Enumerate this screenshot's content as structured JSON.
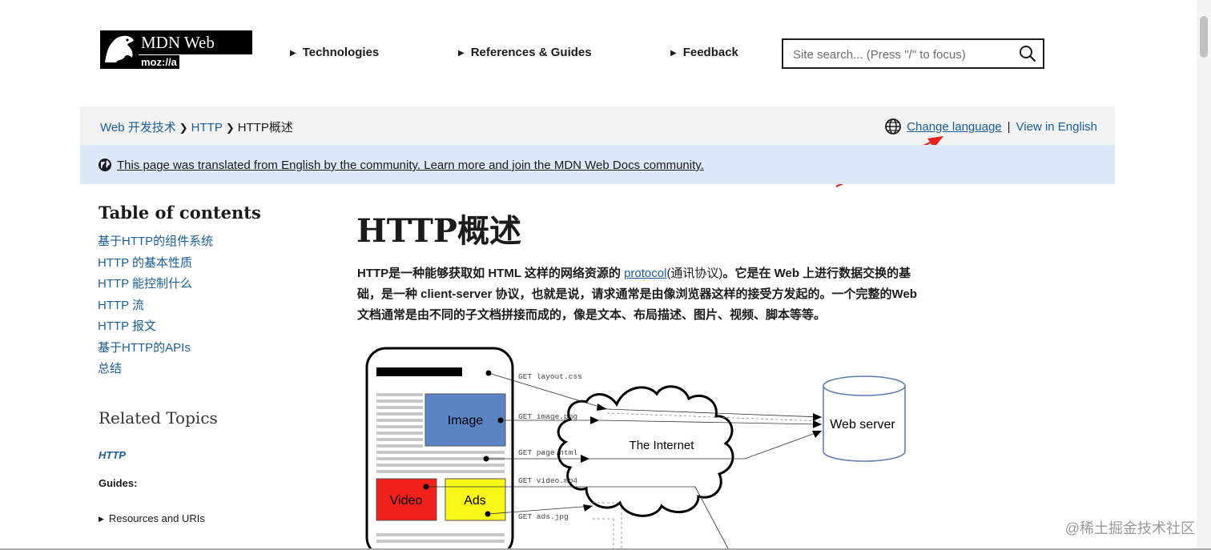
{
  "header": {
    "logo": {
      "name": "MDN Web Docs",
      "moz": "moz://a"
    },
    "nav": [
      {
        "label": "Technologies"
      },
      {
        "label": "References & Guides"
      },
      {
        "label": "Feedback"
      }
    ],
    "search": {
      "placeholder": "Site search... (Press \"/\" to focus)",
      "icon": "search-icon"
    }
  },
  "breadcrumb": {
    "items": [
      "Web 开发技术",
      "HTTP",
      "HTTP概述"
    ],
    "change_language": "Change language",
    "view_in_english": "View in English",
    "separator": "|"
  },
  "notice": {
    "text": "This page was translated from English by the community. Learn more and join the MDN Web Docs community."
  },
  "sidebar": {
    "toc_title": "Table of contents",
    "toc": [
      "基于HTTP的组件系统",
      "HTTP 的基本性质",
      "HTTP 能控制什么",
      "HTTP 流",
      "HTTP 报文",
      "基于HTTP的APIs",
      "总结"
    ],
    "related_title": "Related Topics",
    "related_http": "HTTP",
    "guides_label": "Guides:",
    "resources": "Resources and URIs"
  },
  "main": {
    "title": "HTTP概述",
    "intro_before": "HTTP是一种能够获取如 HTML 这样的网络资源的 ",
    "intro_link": "protocol",
    "intro_paren": "(通讯协议)",
    "intro_after": "。它是在 Web 上进行数据交换的基础，是一种 client-server 协议，也就是说，请求通常是由像浏览器这样的接受方发起的。一个完整的Web文档通常是由不同的子文档拼接而成的，像是文本、布局描述、图片、视频、脚本等等。",
    "diagram": {
      "image_label": "Image",
      "video_label": "Video",
      "ads_label": "Ads",
      "internet_label": "The Internet",
      "server_label": "Web server",
      "requests": [
        "GET layout.css",
        "GET image.png",
        "GET page.html",
        "GET video.mp4",
        "GET ads.jpg"
      ],
      "colors": {
        "image": "#5b84c4",
        "video": "#f0201c",
        "ads": "#f7f71a"
      }
    }
  },
  "watermark": "@稀土掘金技术社区"
}
